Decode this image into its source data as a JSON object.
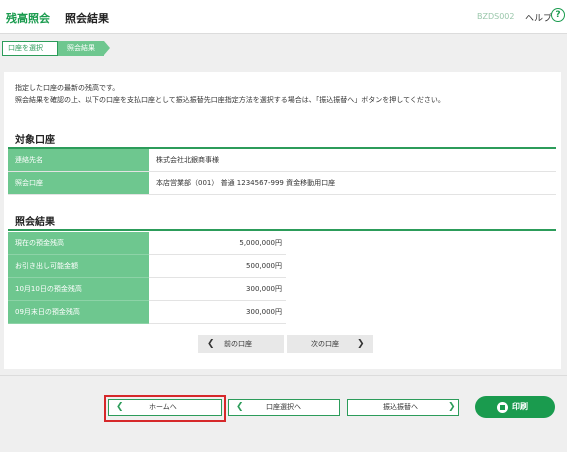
{
  "header": {
    "logo": "残高照会",
    "title": "照会結果",
    "screen_id": "BZDS002",
    "help_label": "ヘルプ",
    "help_icon": "?"
  },
  "steps": [
    {
      "label": "口座を選択",
      "state": "done"
    },
    {
      "label": "照会結果",
      "state": "current"
    }
  ],
  "intro": {
    "line1": "指定した口座の最新の残高です。",
    "line2": "照会結果を確認の上、以下の口座を支払口座として振込振替先口座指定方法を選択する場合は、「振込振替へ」ボタンを押してください。"
  },
  "account": {
    "section_title": "対象口座",
    "rows": [
      {
        "label": "連絡先名",
        "value": "株式会社北銀商事様"
      },
      {
        "label": "照会口座",
        "value": "本店営業部（001） 普通 1234567-999 資金移動用口座"
      }
    ]
  },
  "result": {
    "section_title": "照会結果",
    "rows": [
      {
        "label": "現在の預金残高",
        "value": "5,000,000円"
      },
      {
        "label": "お引き出し可能金額",
        "value": "500,000円"
      },
      {
        "label": "10月10日の預金残高",
        "value": "300,000円"
      },
      {
        "label": "09月末日の預金残高",
        "value": "300,000円"
      }
    ]
  },
  "pager": {
    "prev_label": "前の口座",
    "next_label": "次の口座"
  },
  "footer": {
    "home_label": "ホームへ",
    "account_select_label": "口座選択へ",
    "transfer_label": "振込振替へ",
    "print_label": "印刷"
  },
  "colors": {
    "brand_green": "#1a9b4e",
    "label_bg": "#6ec78f",
    "highlight_red": "#d6282a"
  }
}
